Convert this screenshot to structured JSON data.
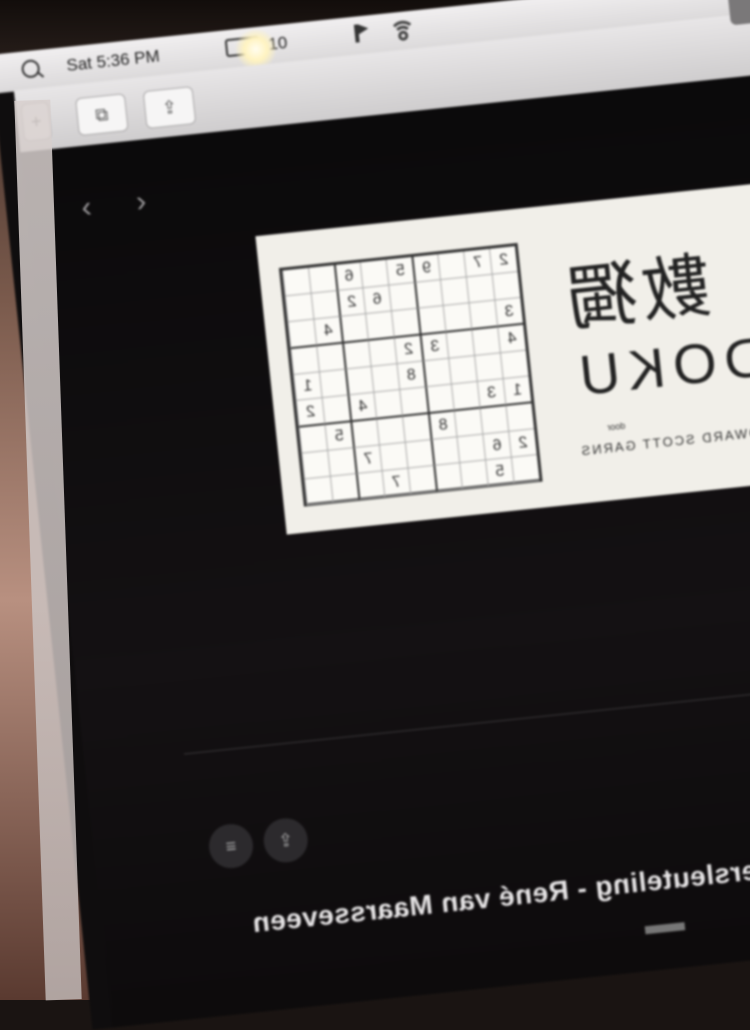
{
  "menubar": {
    "clock": "Sat 5:36 PM",
    "battery_percent": "10"
  },
  "toolbar": {
    "tabs_glyph": "⧉",
    "share_glyph": "⇪",
    "add_glyph": "+"
  },
  "navigation": {
    "back_arrow": "‹",
    "forward_arrow": "›"
  },
  "cover": {
    "title_cjk": "數獨",
    "title_latin": "SUDOKU",
    "door_text": "door",
    "author": "HOWARD SCOTT GARNS",
    "grid": [
      [
        "",
        "",
        "6",
        "",
        "5",
        "9",
        "",
        "7",
        "2"
      ],
      [
        "",
        "",
        "2",
        "6",
        "",
        "",
        "",
        "",
        ""
      ],
      [
        "",
        "4",
        "",
        "",
        "",
        "",
        "",
        "",
        "3"
      ],
      [
        "",
        "",
        "",
        "",
        "2",
        "3",
        "",
        "",
        "4"
      ],
      [
        "1",
        "",
        "",
        "",
        "8",
        "",
        "",
        "",
        ""
      ],
      [
        "2",
        "",
        "4",
        "",
        "",
        "",
        "",
        "3",
        "1"
      ],
      [
        "",
        "5",
        "",
        "",
        "",
        "8",
        "",
        "",
        ""
      ],
      [
        "",
        "",
        "7",
        "",
        "",
        "",
        "",
        "6",
        "2"
      ],
      [
        "",
        "",
        "",
        "7",
        "",
        "",
        "",
        "5",
        ""
      ]
    ]
  },
  "actions": {
    "list_glyph": "≡",
    "share_glyph": "⇪"
  },
  "book": {
    "title": "...ijke versleuteling - René van Maarsseveen"
  },
  "icons": [
    "search-icon",
    "battery-icon",
    "flag-icon",
    "wifi-icon",
    "tabs-icon",
    "share-icon",
    "add-tab-icon",
    "back-arrow-icon",
    "forward-arrow-icon",
    "list-icon"
  ]
}
